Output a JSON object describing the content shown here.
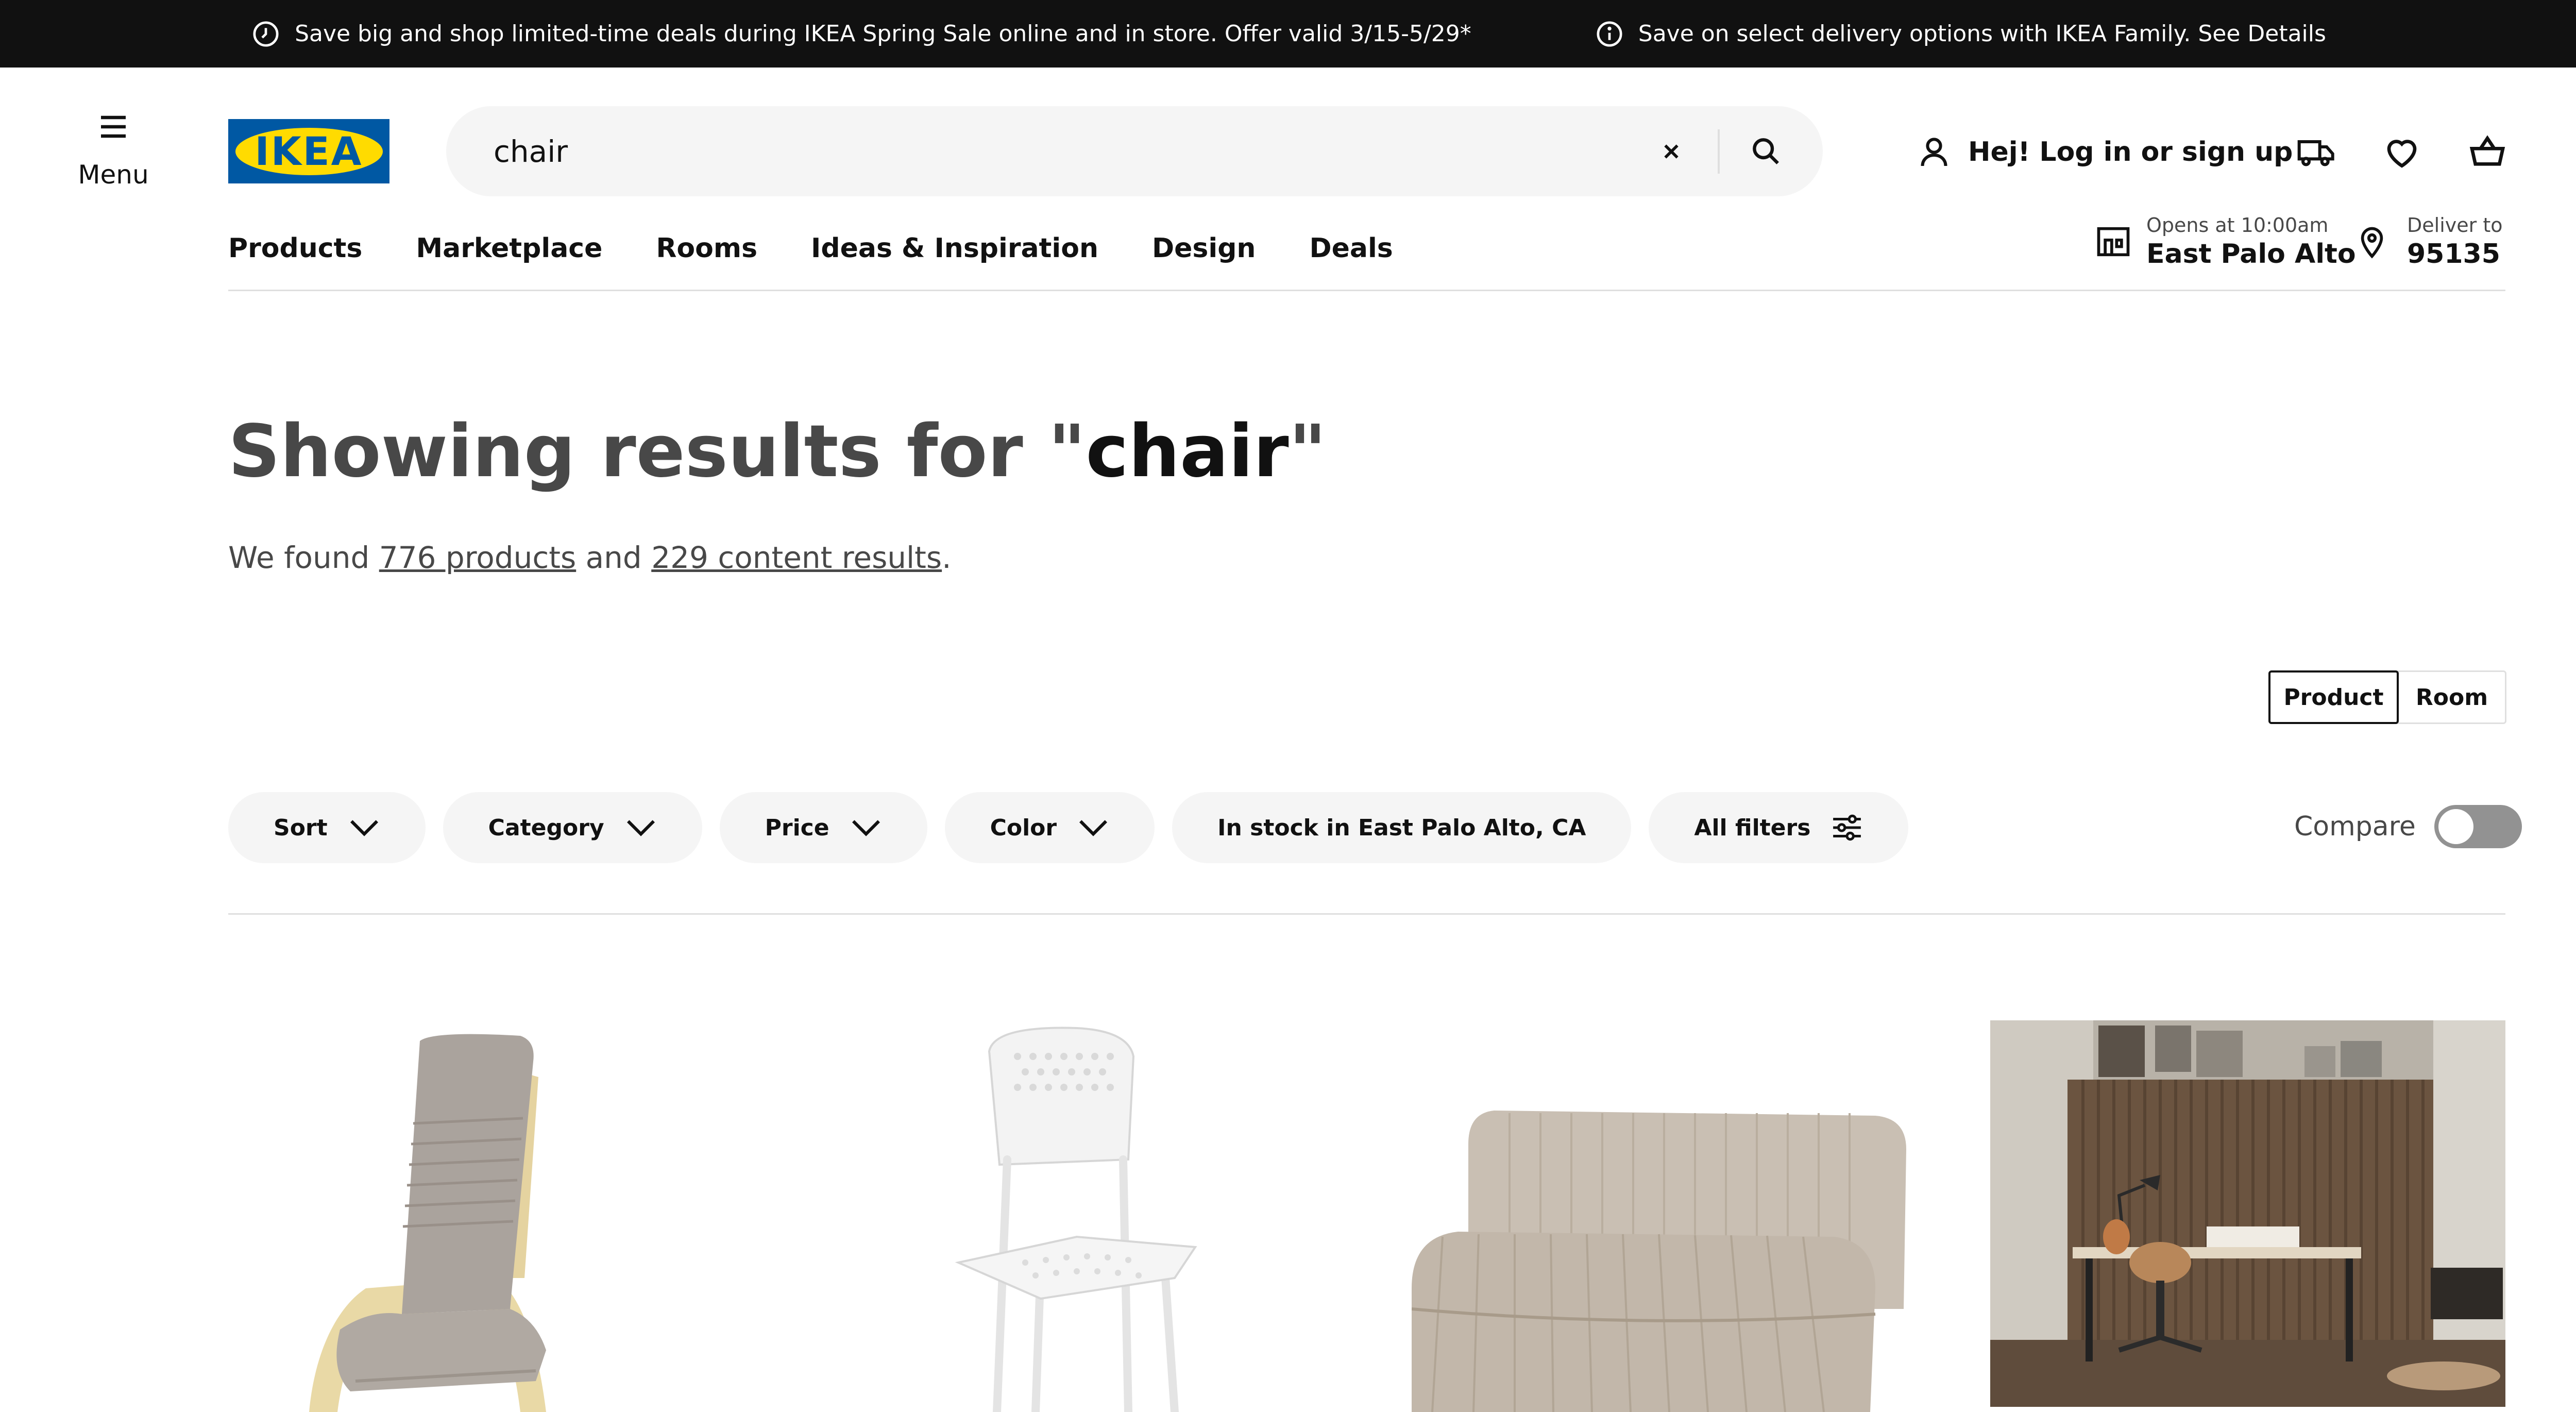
{
  "promo": {
    "message_1": "Save big and shop limited-time deals during IKEA Spring Sale online and in store. Offer valid 3/15-5/29*",
    "message_2": "Save on select delivery options with IKEA Family. See Details",
    "icon_1": "clock-icon",
    "icon_2": "info-icon"
  },
  "header": {
    "menu_label": "Menu",
    "logo_text": "IKEA",
    "search_value": "chair",
    "login_label": "Hej! Log in or sign up"
  },
  "nav": {
    "items": [
      "Products",
      "Marketplace",
      "Rooms",
      "Ideas & Inspiration",
      "Design",
      "Deals"
    ]
  },
  "store": {
    "hours": "Opens at 10:00am",
    "name": "East Palo Alto"
  },
  "delivery": {
    "label": "Deliver to",
    "zip": "95135"
  },
  "results": {
    "title_prefix": "Showing results for \"",
    "query": "chair",
    "title_suffix": "\"",
    "found_prefix": "We found ",
    "products_link": "776 products",
    "and_text": " and ",
    "content_link": "229 content results",
    "period": "."
  },
  "view_toggle": {
    "product": "Product",
    "room": "Room"
  },
  "filters": {
    "sort": "Sort",
    "category": "Category",
    "price": "Price",
    "color": "Color",
    "in_stock": "In stock in East Palo Alto, CA",
    "all_filters": "All filters"
  },
  "compare": {
    "label": "Compare",
    "enabled": false
  },
  "colors": {
    "brand_blue": "#0058a3",
    "brand_yellow": "#ffdb00",
    "promo_bg": "#111111",
    "pill_bg": "#f5f5f5"
  },
  "products": [
    {
      "image": "armchair-image"
    },
    {
      "image": "stacking-chair-image"
    },
    {
      "image": "chair-section-image"
    },
    {
      "image": "home-office-room-image"
    }
  ]
}
